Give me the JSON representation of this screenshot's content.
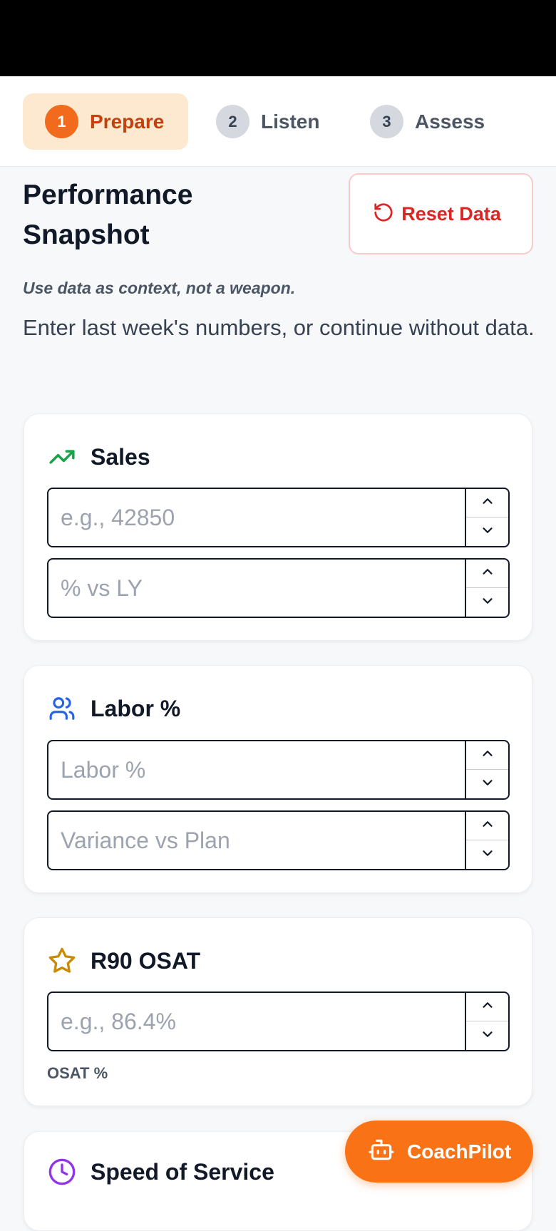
{
  "stepper": {
    "steps": [
      {
        "number": "1",
        "label": "Prepare",
        "active": true
      },
      {
        "number": "2",
        "label": "Listen",
        "active": false
      },
      {
        "number": "3",
        "label": "Assess",
        "active": false
      }
    ]
  },
  "header": {
    "title": "Performance Snapshot",
    "reset_label": "Reset Data",
    "tagline": "Use data as context, not a weapon.",
    "intro": "Enter last week's numbers, or continue without data."
  },
  "cards": {
    "sales": {
      "title": "Sales",
      "icon": "trending-up-icon",
      "icon_color": "#16a34a",
      "fields": [
        {
          "placeholder": "e.g., 42850",
          "value": ""
        },
        {
          "placeholder": "% vs LY",
          "value": ""
        }
      ]
    },
    "labor": {
      "title": "Labor %",
      "icon": "users-icon",
      "icon_color": "#2563eb",
      "fields": [
        {
          "placeholder": "Labor %",
          "value": ""
        },
        {
          "placeholder": "Variance vs Plan",
          "value": ""
        }
      ]
    },
    "osat": {
      "title": "R90 OSAT",
      "icon": "star-icon",
      "icon_color": "#ca8a04",
      "fields": [
        {
          "placeholder": "e.g., 86.4%",
          "value": ""
        }
      ],
      "helper": "OSAT %"
    },
    "sos": {
      "title": "Speed of Service",
      "icon": "clock-icon",
      "icon_color": "#9333ea"
    }
  },
  "fab": {
    "label": "CoachPilot",
    "icon": "bot-icon",
    "color": "#f97316"
  },
  "colors": {
    "accent": "#f26a1b",
    "active_step_bg": "#fde9cf",
    "active_step_text": "#c2410c",
    "danger": "#dc2626"
  }
}
